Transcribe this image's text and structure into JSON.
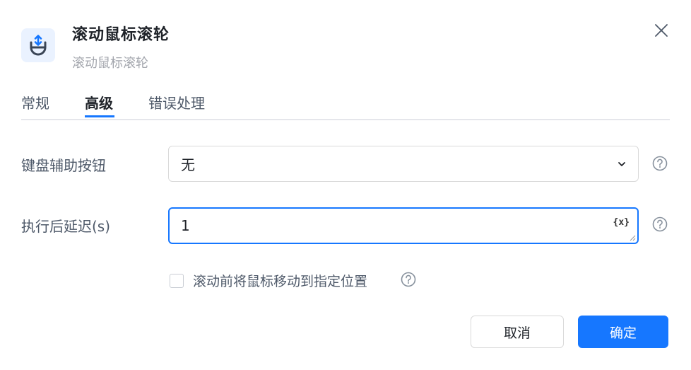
{
  "header": {
    "title": "滚动鼠标滚轮",
    "subtitle": "滚动鼠标滚轮",
    "icon": "mouse-scroll-icon",
    "close_icon": "close-icon"
  },
  "tabs": [
    {
      "label": "常规",
      "active": false
    },
    {
      "label": "高级",
      "active": true
    },
    {
      "label": "错误处理",
      "active": false
    }
  ],
  "form": {
    "keyboard_assist": {
      "label": "键盘辅助按钮",
      "value": "无"
    },
    "delay_after": {
      "label": "执行后延迟(s)",
      "value": "1",
      "variable_button": "{x}"
    },
    "move_before_scroll": {
      "label": "滚动前将鼠标移动到指定位置",
      "checked": false
    }
  },
  "buttons": {
    "cancel": "取消",
    "ok": "确定"
  },
  "colors": {
    "primary": "#1677ff",
    "icon_bg": "#eaf2ff"
  }
}
